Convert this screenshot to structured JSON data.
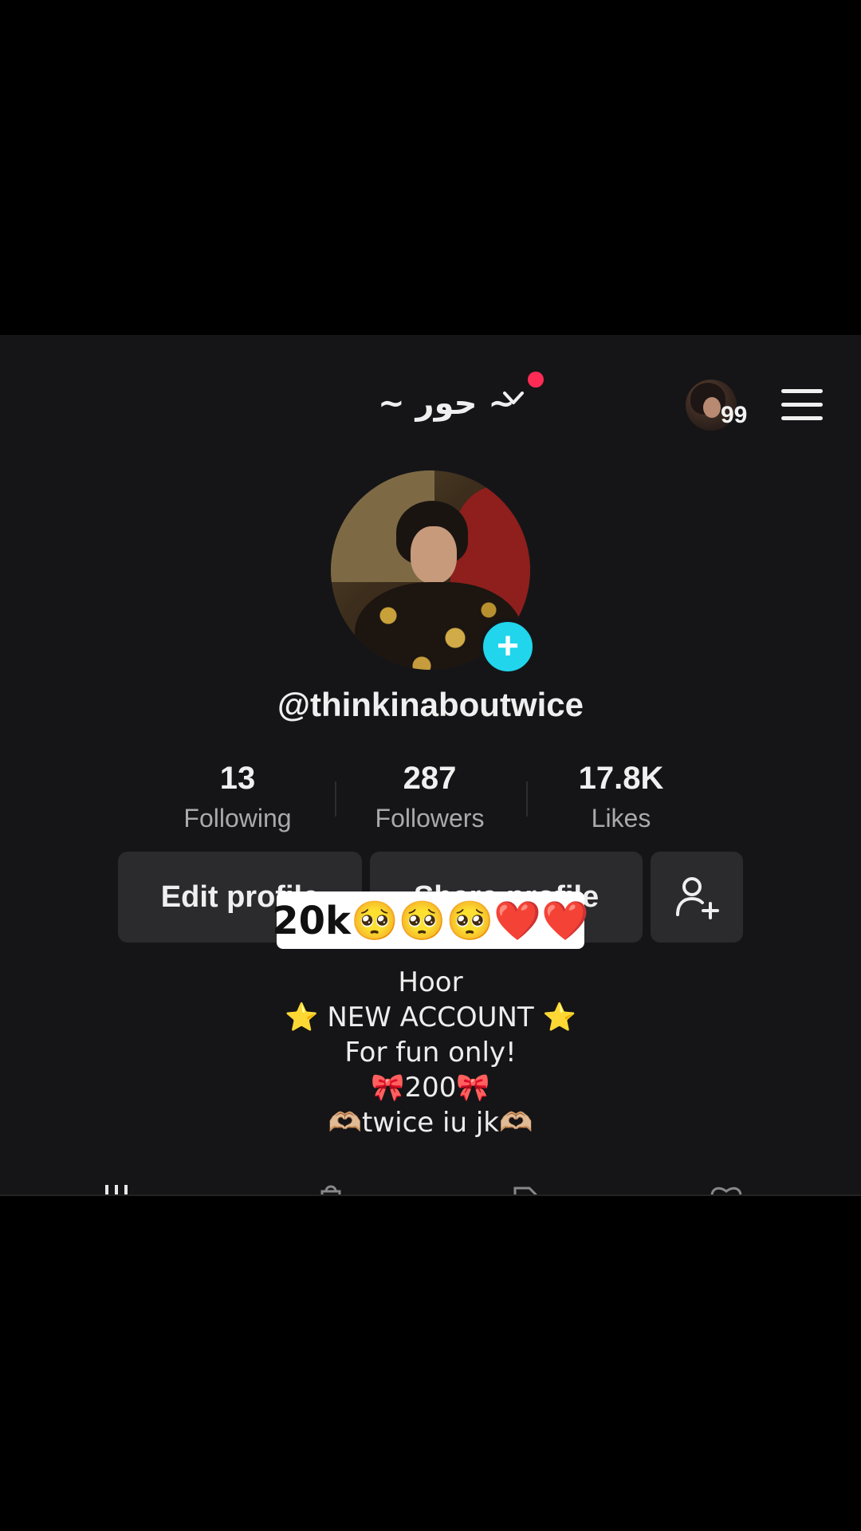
{
  "header": {
    "display_name": "~ حور ~",
    "notification_count": "99"
  },
  "profile": {
    "username": "@thinkinaboutwice"
  },
  "stats": [
    {
      "value": "13",
      "label": "Following"
    },
    {
      "value": "287",
      "label": "Followers"
    },
    {
      "value": "17.8K",
      "label": "Likes"
    }
  ],
  "buttons": {
    "edit_profile": "Edit profile",
    "share_profile": "Share profile"
  },
  "sticker": {
    "text": "20k🥺🥺🥺❤️❤️"
  },
  "bio": {
    "lines": [
      "Hoor",
      "⭐ NEW ACCOUNT ⭐",
      "For fun only!",
      "🎀200🎀",
      "🫶🏼twice iu jk🫶🏼"
    ]
  },
  "icons": {
    "avatar_add": "plus-icon",
    "menu": "hamburger-menu-icon",
    "dropdown": "chevron-down-icon",
    "add_friend": "add-friend-icon",
    "tabs": [
      "grid-icon",
      "shop-bag-icon",
      "repost-icon",
      "liked-heart-icon"
    ]
  },
  "colors": {
    "background": "#151517",
    "accent_cyan": "#20d5ec",
    "notification_red": "#fe2c55",
    "button_bg": "#2b2b2e"
  }
}
